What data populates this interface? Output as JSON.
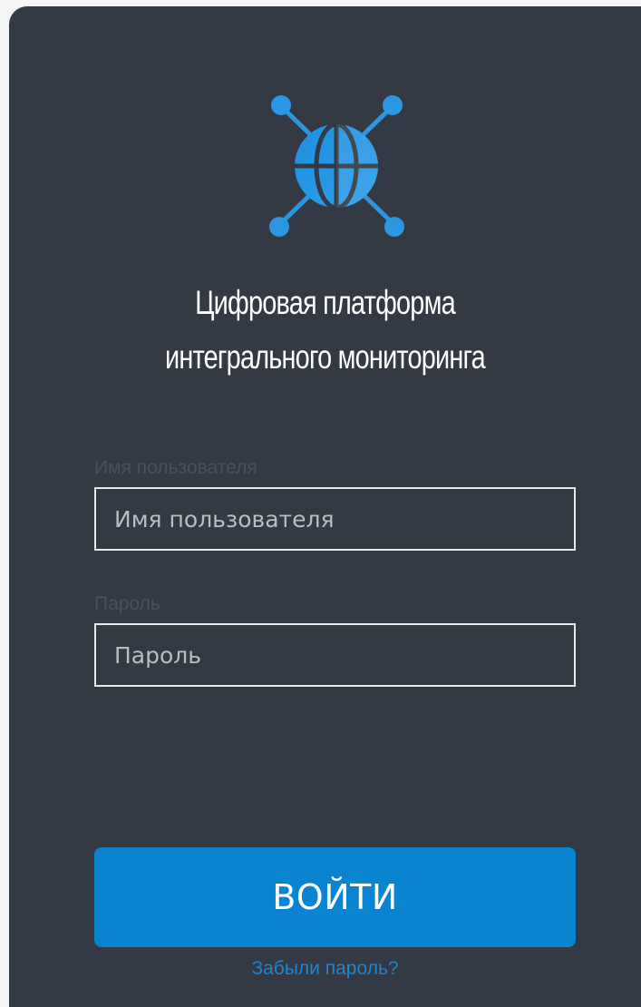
{
  "brand": {
    "title_line1": "Цифровая платформа",
    "title_line2": "интегрального мониторинга",
    "logo_icon": "globe-network-icon",
    "accent_color": "#1a8fd8"
  },
  "form": {
    "username": {
      "label": "Имя пользователя",
      "placeholder": "Имя пользователя",
      "value": ""
    },
    "password": {
      "label": "Пароль",
      "placeholder": "Пароль",
      "value": ""
    },
    "submit_label": "ВОЙТИ",
    "forgot_label": "Забыли пароль?"
  },
  "colors": {
    "card_background": "#343a43",
    "button_background": "#0a84d0",
    "link_color": "#1b86d3"
  }
}
